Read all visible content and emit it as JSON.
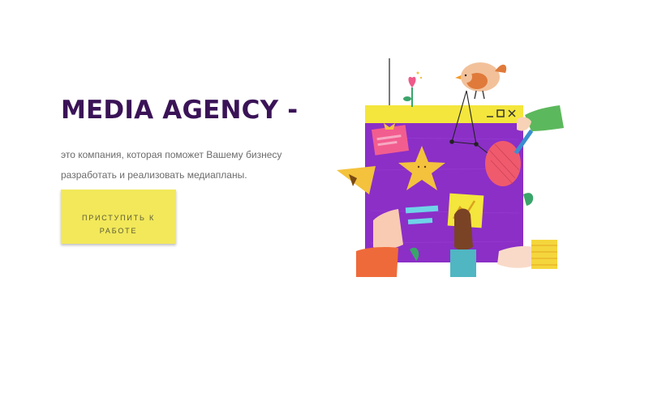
{
  "hero": {
    "title": "MEDIA AGENCY -",
    "description": "это компания, которая поможет Вашему бизнесу разработать и реализовать медиапланы.",
    "cta_label": "ПРИСТУПИТЬ К РАБОТЕ"
  },
  "colors": {
    "title": "#3a1357",
    "button": "#f2e85a",
    "board": "#8b2fc7",
    "board_top_bar": "#f4e63c",
    "text": "#6c6c6c"
  },
  "illustration": {
    "icons": [
      "bird-icon",
      "flower-icon",
      "star-icon",
      "heart-icon",
      "hand-icon",
      "window-controls-icon"
    ]
  }
}
